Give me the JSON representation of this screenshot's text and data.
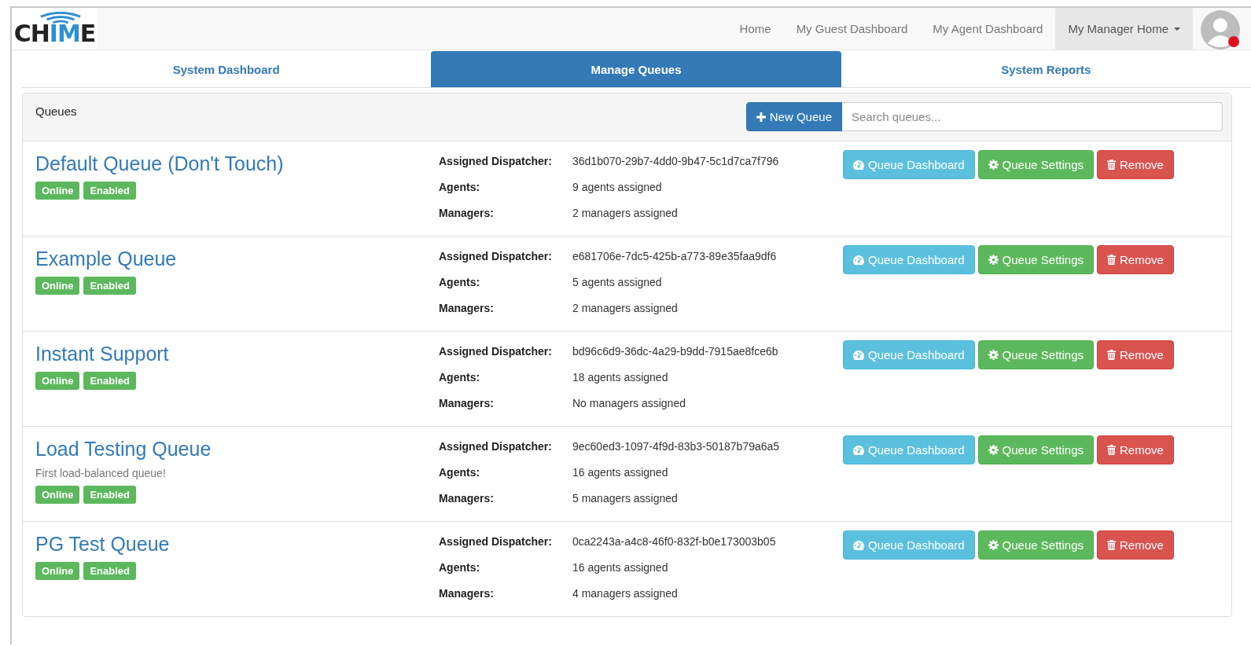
{
  "logo": [
    {
      "text": "CH",
      "kind": "dark"
    },
    {
      "text": "IM",
      "kind": "accent"
    },
    {
      "text": "E",
      "kind": "dark"
    }
  ],
  "nav": [
    {
      "label": "Home",
      "selected": false,
      "dropdown": false
    },
    {
      "label": "My Guest Dashboard",
      "selected": false,
      "dropdown": false
    },
    {
      "label": "My Agent Dashboard",
      "selected": false,
      "dropdown": false
    },
    {
      "label": "My Manager Home",
      "selected": true,
      "dropdown": true
    }
  ],
  "tabs": [
    {
      "label": "System Dashboard",
      "selected": false
    },
    {
      "label": "Manage Queues",
      "selected": true
    },
    {
      "label": "System Reports",
      "selected": false
    }
  ],
  "panel": {
    "title": "Queues",
    "new_button": "New Queue",
    "search": {
      "placeholder": "Search queues..."
    }
  },
  "queues": [
    {
      "name": "Default Queue (Don't Touch)",
      "badges": [
        {
          "label": "Online",
          "kind": "success"
        },
        {
          "label": "Enabled",
          "kind": "success"
        }
      ],
      "details": [
        {
          "label": "Assigned Dispatcher:",
          "value": "36d1b070-29b7-4dd0-9b47-5c1d7ca7f796"
        },
        {
          "label": "Agents:",
          "value": "9 agents assigned"
        },
        {
          "label": "Managers:",
          "value": "2 managers assigned"
        }
      ],
      "buttons": [
        {
          "label": "Queue Dashboard",
          "kind": "dashboard"
        },
        {
          "label": "Queue Settings",
          "kind": "settings"
        },
        {
          "label": "Remove",
          "kind": "remove"
        }
      ]
    },
    {
      "name": "Example Queue",
      "badges": [
        {
          "label": "Online",
          "kind": "success"
        },
        {
          "label": "Enabled",
          "kind": "success"
        }
      ],
      "details": [
        {
          "label": "Assigned Dispatcher:",
          "value": "e681706e-7dc5-425b-a773-89e35faa9df6"
        },
        {
          "label": "Agents:",
          "value": "5 agents assigned"
        },
        {
          "label": "Managers:",
          "value": "2 managers assigned"
        }
      ],
      "buttons": [
        {
          "label": "Queue Dashboard",
          "kind": "dashboard"
        },
        {
          "label": "Queue Settings",
          "kind": "settings"
        },
        {
          "label": "Remove",
          "kind": "remove"
        }
      ]
    },
    {
      "name": "Instant Support",
      "badges": [
        {
          "label": "Online",
          "kind": "success"
        },
        {
          "label": "Enabled",
          "kind": "success"
        }
      ],
      "details": [
        {
          "label": "Assigned Dispatcher:",
          "value": "bd96c6d9-36dc-4a29-b9dd-7915ae8fce6b"
        },
        {
          "label": "Agents:",
          "value": "18 agents assigned"
        },
        {
          "label": "Managers:",
          "value": "No managers assigned"
        }
      ],
      "buttons": [
        {
          "label": "Queue Dashboard",
          "kind": "dashboard"
        },
        {
          "label": "Queue Settings",
          "kind": "settings"
        },
        {
          "label": "Remove",
          "kind": "remove"
        }
      ]
    },
    {
      "name": "Load Testing Queue",
      "description": "First load-balanced queue!",
      "badges": [
        {
          "label": "Online",
          "kind": "success"
        },
        {
          "label": "Enabled",
          "kind": "success"
        }
      ],
      "details": [
        {
          "label": "Assigned Dispatcher:",
          "value": "9ec60ed3-1097-4f9d-83b3-50187b79a6a5"
        },
        {
          "label": "Agents:",
          "value": "16 agents assigned"
        },
        {
          "label": "Managers:",
          "value": "5 managers assigned"
        }
      ],
      "buttons": [
        {
          "label": "Queue Dashboard",
          "kind": "dashboard"
        },
        {
          "label": "Queue Settings",
          "kind": "settings"
        },
        {
          "label": "Remove",
          "kind": "remove"
        }
      ]
    },
    {
      "name": "PG Test Queue",
      "badges": [
        {
          "label": "Online",
          "kind": "success"
        },
        {
          "label": "Enabled",
          "kind": "success"
        }
      ],
      "details": [
        {
          "label": "Assigned Dispatcher:",
          "value": "0ca2243a-a4c8-46f0-832f-b0e173003b05"
        },
        {
          "label": "Agents:",
          "value": "16 agents assigned"
        },
        {
          "label": "Managers:",
          "value": "4 managers assigned"
        }
      ],
      "buttons": [
        {
          "label": "Queue Dashboard",
          "kind": "dashboard"
        },
        {
          "label": "Queue Settings",
          "kind": "settings"
        },
        {
          "label": "Remove",
          "kind": "remove"
        }
      ]
    }
  ]
}
